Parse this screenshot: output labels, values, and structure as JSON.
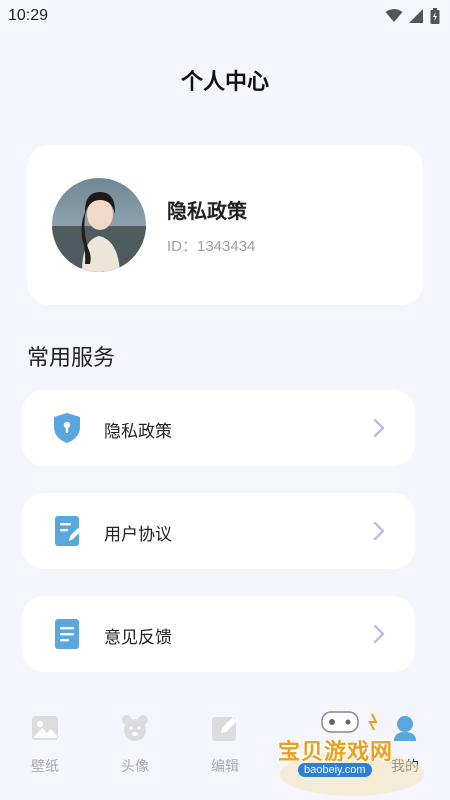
{
  "status": {
    "time": "10:29"
  },
  "header": {
    "title": "个人中心"
  },
  "profile": {
    "name": "隐私政策",
    "id_text": "ID：1343434"
  },
  "services": {
    "title": "常用服务",
    "items": [
      {
        "label": "隐私政策",
        "icon": "shield-icon"
      },
      {
        "label": "用户协议",
        "icon": "document-edit-icon"
      },
      {
        "label": "意见反馈",
        "icon": "document-icon"
      }
    ]
  },
  "tabbar": {
    "items": [
      {
        "label": "壁纸",
        "icon": "image-icon"
      },
      {
        "label": "头像",
        "icon": "bear-face-icon"
      },
      {
        "label": "编辑",
        "icon": "edit-icon"
      },
      {
        "label": "我的",
        "icon": "user-icon",
        "active": true
      }
    ]
  },
  "watermark": {
    "text": "宝贝游戏网",
    "url": "baobeiy.com"
  },
  "colors": {
    "background": "#f5f5fd",
    "accent_blue": "#5aa6df",
    "chevron": "#b9c0e6"
  }
}
